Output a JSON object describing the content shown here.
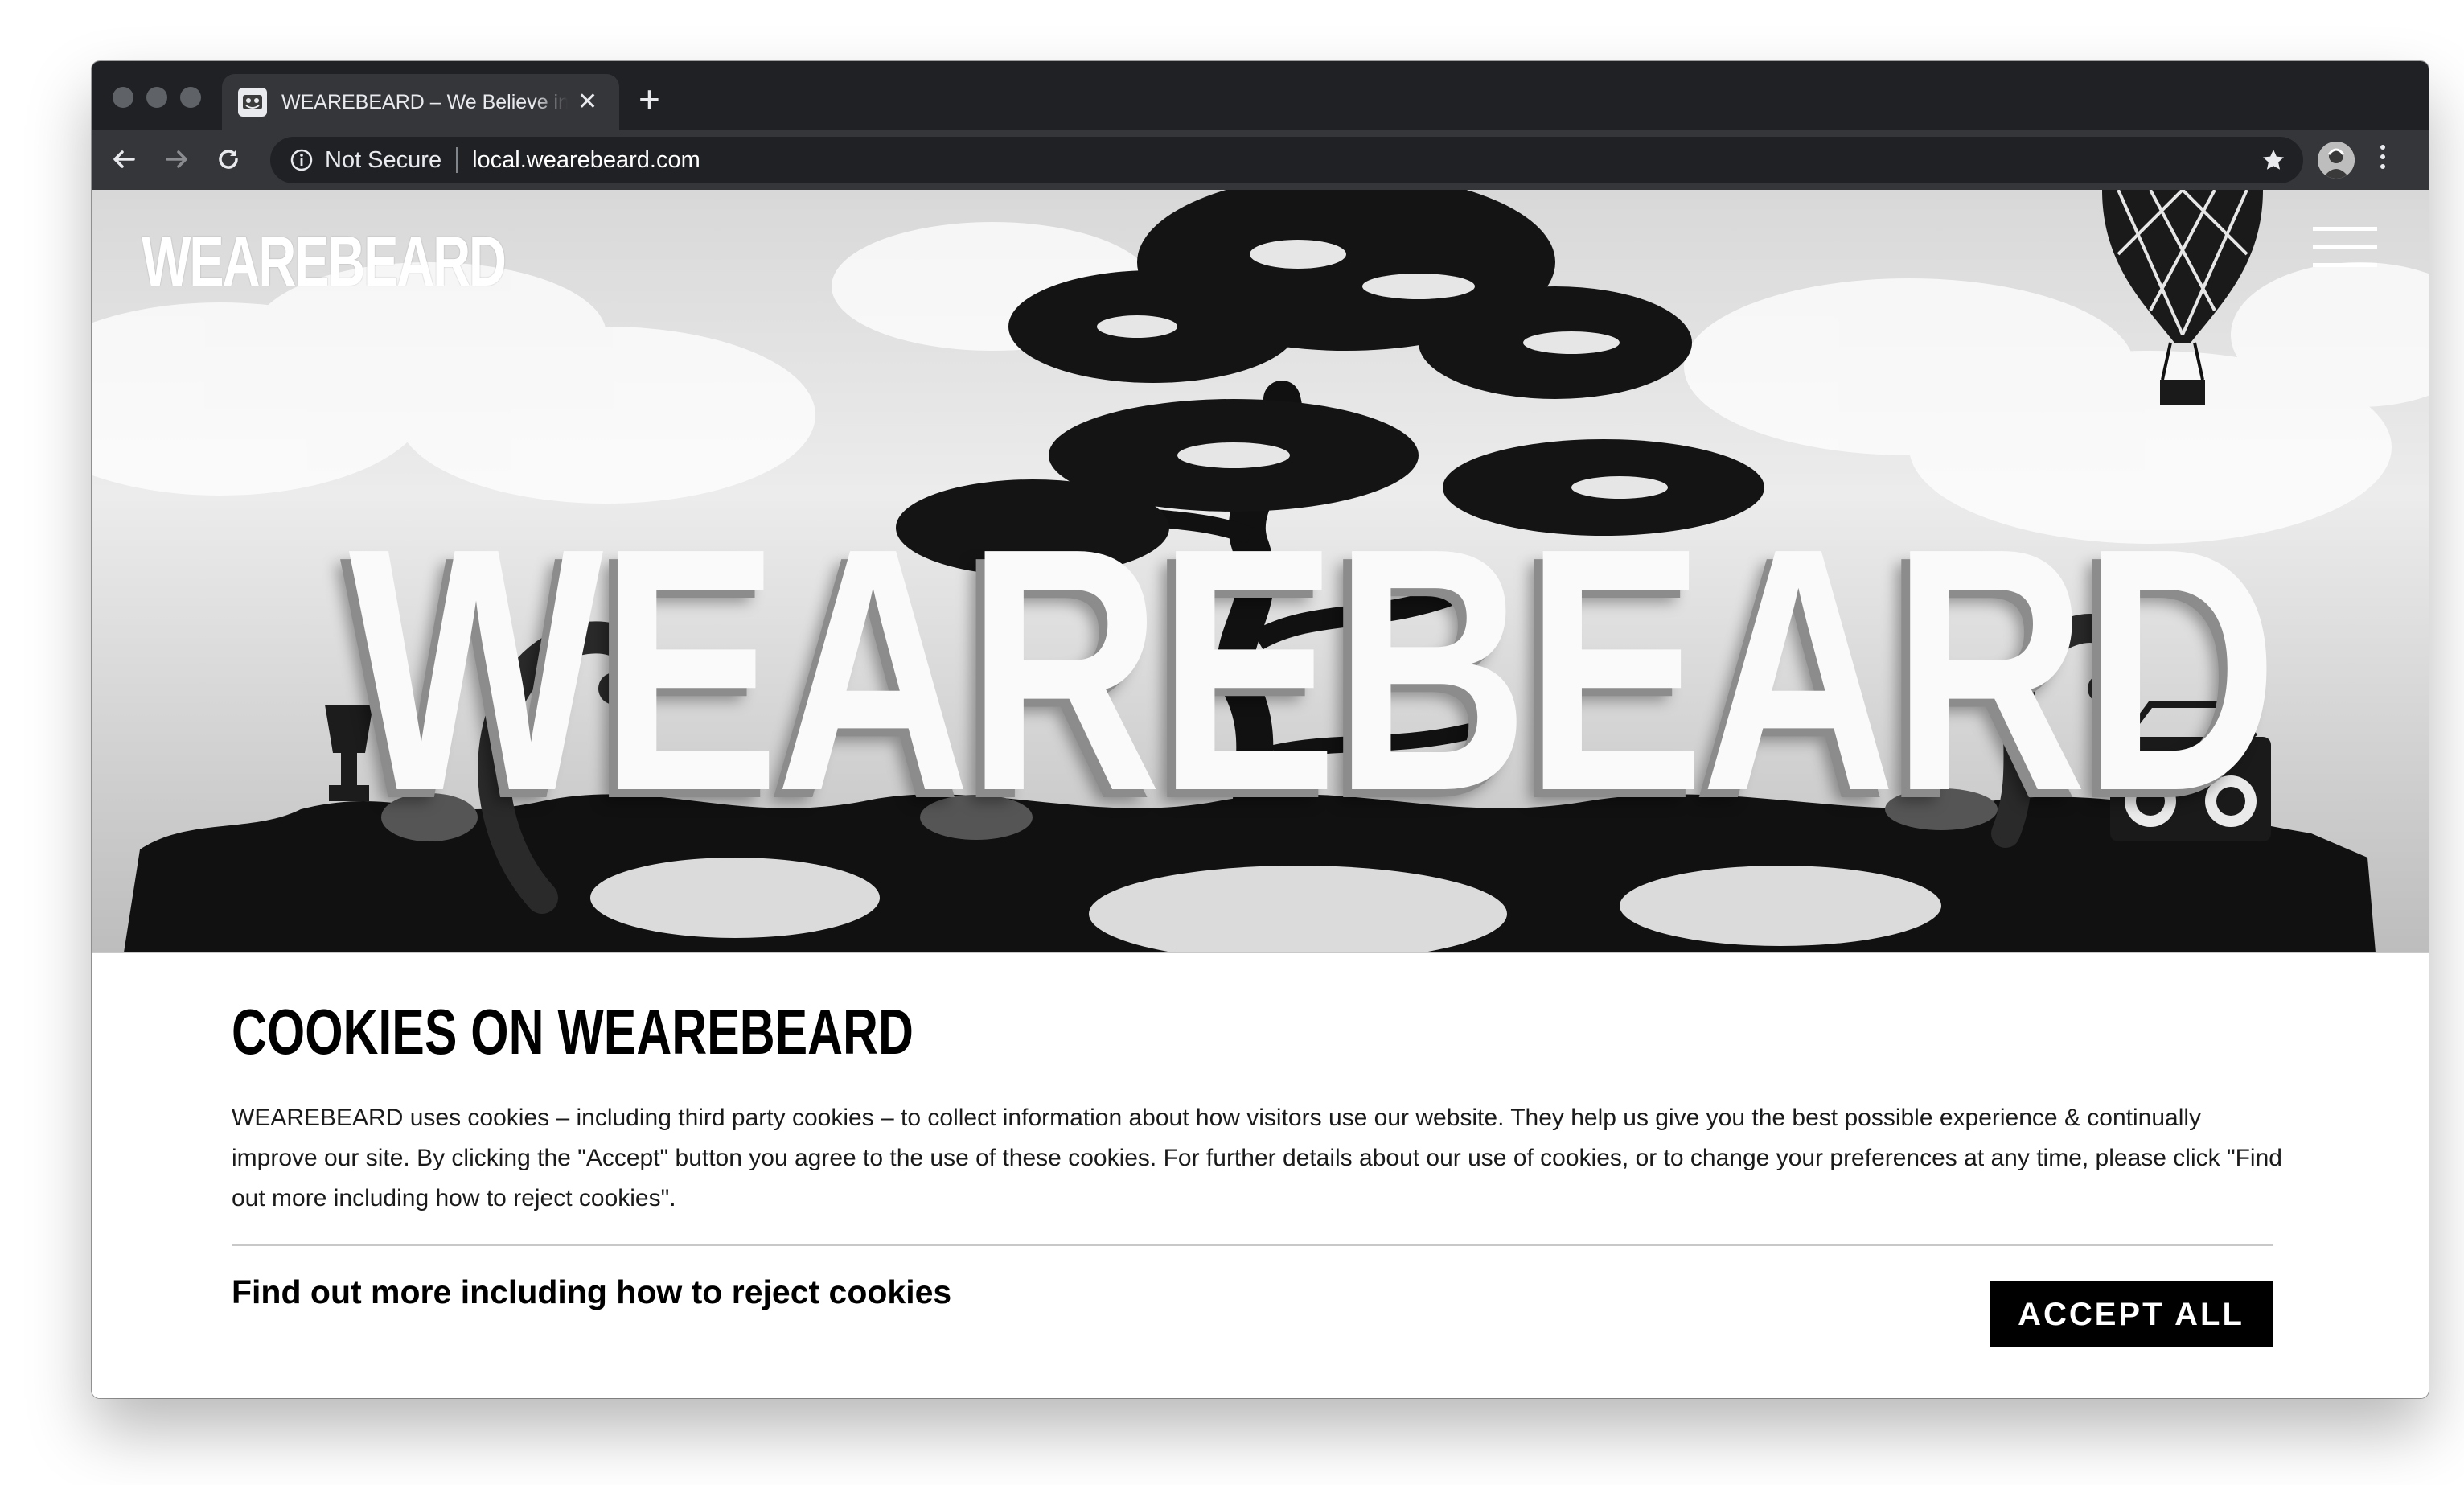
{
  "browser": {
    "tab_title": "WEAREBEARD – We Believe in Creativity",
    "tab_close": "✕",
    "new_tab": "+",
    "security_label": "Not Secure",
    "url": "local.wearebeard.com"
  },
  "site": {
    "logo_text": "WEAREBEARD",
    "hero_word": "WEAREBEARD"
  },
  "cookie_banner": {
    "title": "COOKIES ON WEAREBEARD",
    "body": "WEAREBEARD uses cookies – including third party cookies – to collect information about how visitors use our website. They help us give you the best possible experience & continually improve our site. By clicking the \"Accept\" button you agree to the use of these cookies. For further details about our use of cookies, or to change your preferences at any time, please click \"Find out more including how to reject cookies\".",
    "more_link": "Find out more including how to reject cookies",
    "accept_label": "ACCEPT ALL"
  },
  "icons": [
    "back-arrow-icon",
    "forward-arrow-icon",
    "reload-icon",
    "info-icon",
    "star-icon",
    "menu-icon",
    "hot-air-balloon",
    "tree-illustration"
  ]
}
